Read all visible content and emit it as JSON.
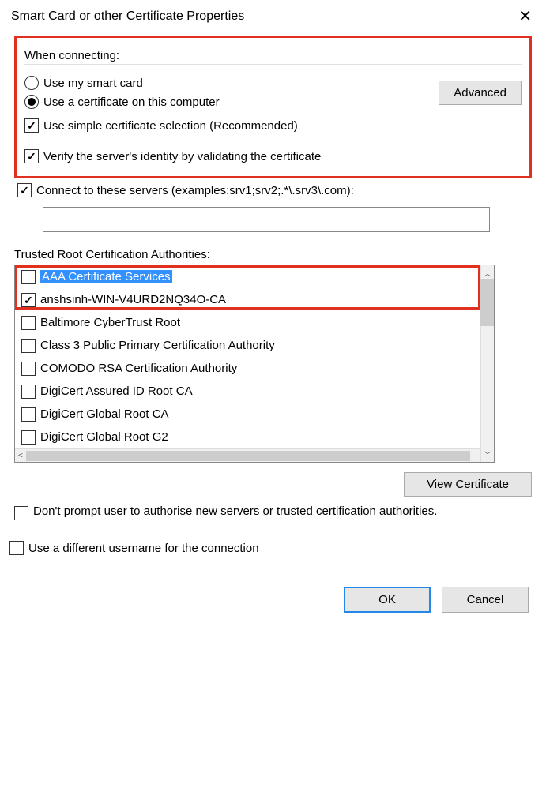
{
  "title": "Smart Card or other Certificate Properties",
  "connecting": {
    "heading": "When connecting:",
    "radio_smartcard": "Use my smart card",
    "radio_computer": "Use a certificate on this computer",
    "advanced_btn": "Advanced",
    "simple_selection": "Use simple certificate selection (Recommended)"
  },
  "verify_identity": "Verify the server's identity by validating the certificate",
  "connect_servers_label": "Connect to these servers (examples:srv1;srv2;.*\\.srv3\\.com):",
  "servers_input": "",
  "trusted_label": "Trusted Root Certification Authorities:",
  "ca_list": [
    {
      "name": "AAA Certificate Services",
      "checked": false,
      "selected": true
    },
    {
      "name": "anshsinh-WIN-V4URD2NQ34O-CA",
      "checked": true,
      "selected": false
    },
    {
      "name": "Baltimore CyberTrust Root",
      "checked": false,
      "selected": false
    },
    {
      "name": "Class 3 Public Primary Certification Authority",
      "checked": false,
      "selected": false
    },
    {
      "name": "COMODO RSA Certification Authority",
      "checked": false,
      "selected": false
    },
    {
      "name": "DigiCert Assured ID Root CA",
      "checked": false,
      "selected": false
    },
    {
      "name": "DigiCert Global Root CA",
      "checked": false,
      "selected": false
    },
    {
      "name": "DigiCert Global Root G2",
      "checked": false,
      "selected": false
    }
  ],
  "view_cert_btn": "View Certificate",
  "dont_prompt": "Don't prompt user to authorise new servers or trusted certification authorities.",
  "diff_username": "Use a different username for the connection",
  "ok_btn": "OK",
  "cancel_btn": "Cancel"
}
